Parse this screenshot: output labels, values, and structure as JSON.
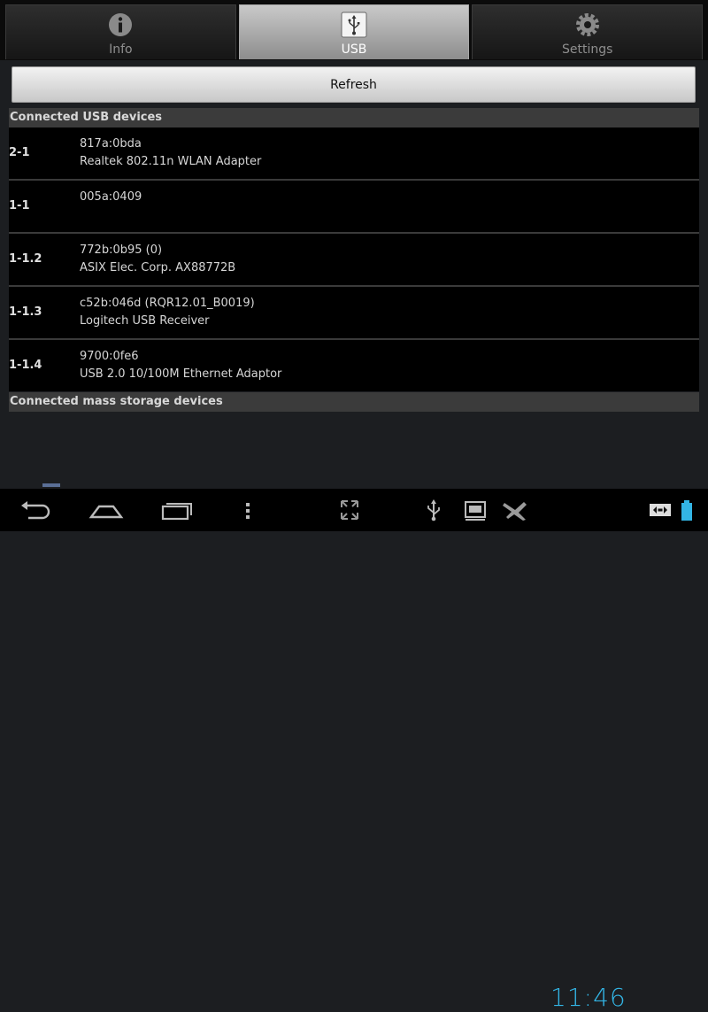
{
  "tabs": [
    {
      "label": "Info",
      "icon": "info-icon",
      "selected": false
    },
    {
      "label": "USB",
      "icon": "usb-icon",
      "selected": true
    },
    {
      "label": "Settings",
      "icon": "settings-icon",
      "selected": false
    }
  ],
  "refresh_label": "Refresh",
  "sections": {
    "usb_header": "Connected USB devices",
    "mass_storage_header": "Connected mass storage devices"
  },
  "devices": [
    {
      "port": "2-1",
      "ids": "817a:0bda",
      "name": "Realtek 802.11n WLAN Adapter"
    },
    {
      "port": "1-1",
      "ids": "005a:0409",
      "name": ""
    },
    {
      "port": "1-1.2",
      "ids": "772b:0b95 (0)",
      "name": "ASIX Elec. Corp. AX88772B"
    },
    {
      "port": "1-1.3",
      "ids": "c52b:046d (RQR12.01_B0019)",
      "name": "Logitech USB Receiver"
    },
    {
      "port": "1-1.4",
      "ids": "9700:0fe6",
      "name": "USB 2.0 10/100M Ethernet Adaptor"
    }
  ],
  "status": {
    "clock": "11:46",
    "accent": "#33b5e5"
  },
  "navbar_icons": [
    "back-icon",
    "home-icon",
    "recent-apps-icon",
    "menu-icon",
    "fullscreen-icon",
    "usb-status-icon",
    "screenshot-icon",
    "airplane-mode-icon",
    "network-icon",
    "battery-icon"
  ]
}
